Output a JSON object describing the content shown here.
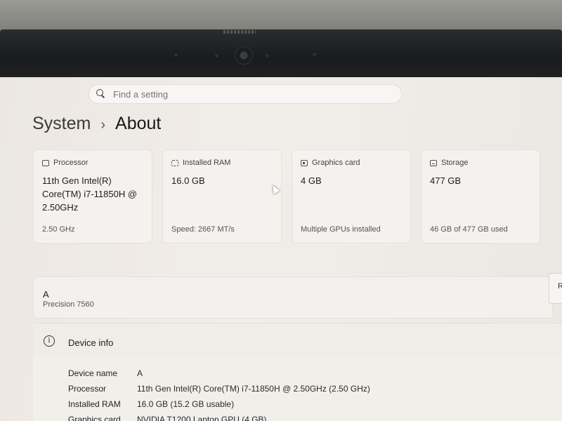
{
  "search": {
    "placeholder": "Find a setting"
  },
  "breadcrumb": {
    "parent": "System",
    "separator": "›",
    "current": "About"
  },
  "cards": [
    {
      "label": "Processor",
      "value": "11th Gen Intel(R) Core(TM) i7-11850H @ 2.50GHz",
      "sub": "2.50 GHz",
      "icon": "processor-icon"
    },
    {
      "label": "Installed RAM",
      "value": "16.0 GB",
      "sub": "Speed: 2667 MT/s",
      "icon": "ram-icon"
    },
    {
      "label": "Graphics card",
      "value": "4 GB",
      "sub": "Multiple GPUs installed",
      "icon": "graphics-card-icon"
    },
    {
      "label": "Storage",
      "value": "477 GB",
      "sub": "46 GB of 477 GB used",
      "icon": "storage-icon"
    }
  ],
  "device": {
    "name": "A",
    "model": "Precision 7560",
    "rename_partial": "R"
  },
  "device_info": {
    "title": "Device info",
    "icon_glyph": "i",
    "rows": [
      {
        "label": "Device name",
        "value": "A"
      },
      {
        "label": "Processor",
        "value": "11th Gen Intel(R) Core(TM) i7-11850H @ 2.50GHz (2.50 GHz)"
      },
      {
        "label": "Installed RAM",
        "value": "16.0 GB (15.2 GB usable)"
      },
      {
        "label": "Graphics card",
        "value": "NVIDIA T1200 Laptop GPU (4 GB)"
      }
    ]
  }
}
